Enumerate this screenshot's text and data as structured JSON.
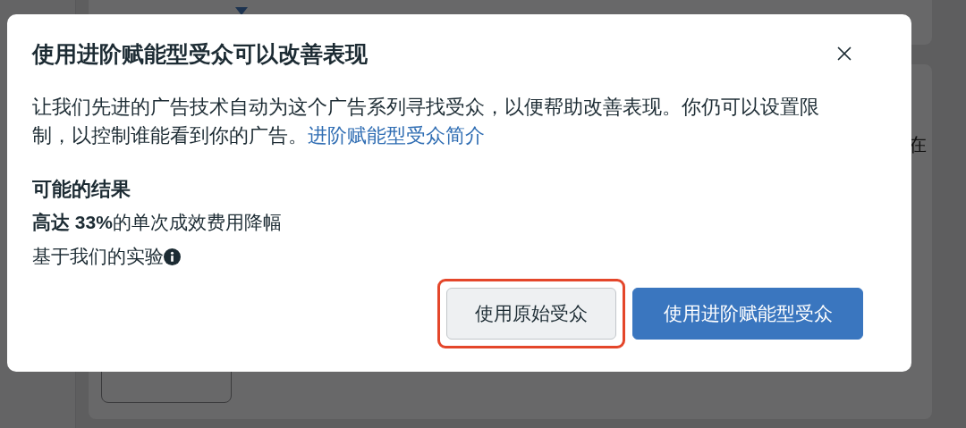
{
  "background": {
    "side_text": "在"
  },
  "dialog": {
    "title": "使用进阶赋能型受众可以改善表现",
    "body": "让我们先进的广告技术自动为这个广告系列寻找受众，以便帮助改善表现。你仍可以设置限制，以控制谁能看到你的广告。",
    "link": "进阶赋能型受众简介",
    "results_heading": "可能的结果",
    "result": "**高达 33%**的单次成效费用降幅",
    "note": "基于我们的实验",
    "buttons": [
      {
        "label": "使用原始受众",
        "kind": "secondary",
        "highlighted": true
      },
      {
        "label": "使用进阶赋能型受众",
        "kind": "primary",
        "highlighted": false
      }
    ]
  }
}
